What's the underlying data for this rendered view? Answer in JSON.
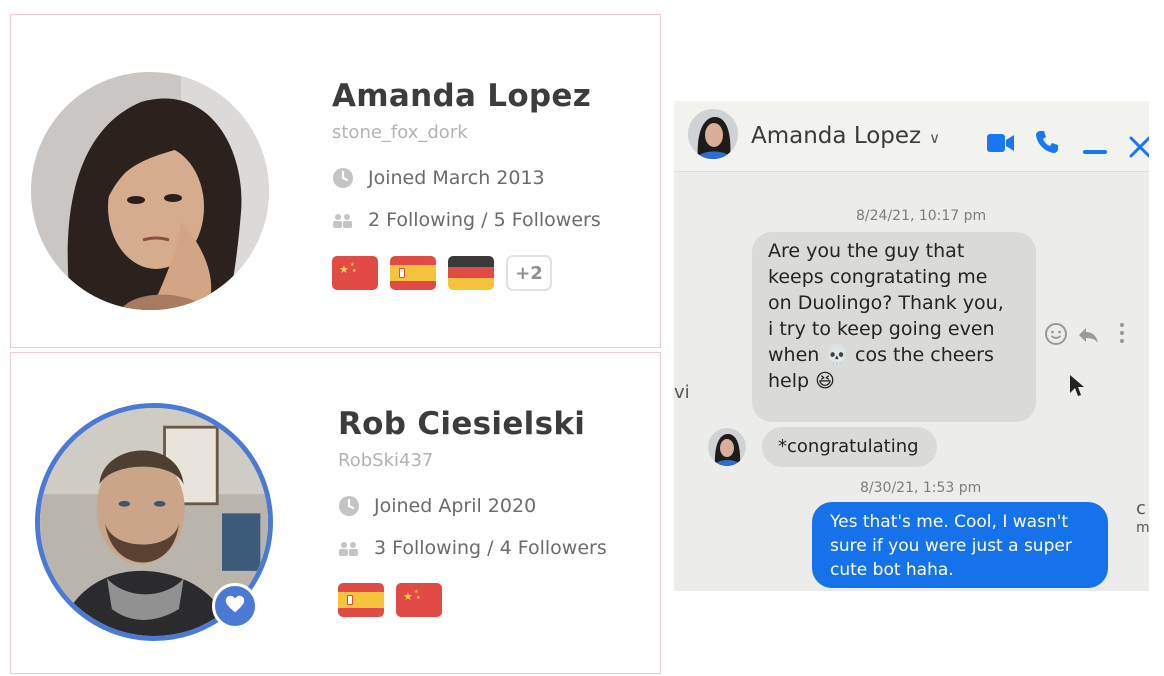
{
  "profiles": [
    {
      "name": "Amanda Lopez",
      "username": "stone_fox_dork",
      "joined": "Joined March 2013",
      "follow": "2 Following / 5 Followers",
      "flags": [
        "china",
        "spain",
        "germany"
      ],
      "more_flags": "+2"
    },
    {
      "name": "Rob Ciesielski",
      "username": "RobSki437",
      "joined": "Joined April 2020",
      "follow": "3 Following / 4 Followers",
      "flags": [
        "spain",
        "china"
      ]
    }
  ],
  "chat": {
    "contact_name": "Amanda Lopez",
    "header_icons": [
      "video-call-icon",
      "phone-icon",
      "minimize-icon",
      "close-icon"
    ],
    "messages": [
      {
        "timestamp": "8/24/21, 10:17 pm"
      },
      {
        "from": "them",
        "lines": [
          "Are you the guy that",
          "keeps congratating me",
          "on Duolingo? Thank you,",
          "i try to keep going even",
          "when 💀 cos the cheers",
          "help 😆"
        ]
      },
      {
        "from": "them",
        "text": "*congratulating"
      },
      {
        "timestamp": "8/30/21, 1:53 pm"
      },
      {
        "from": "me",
        "lines": [
          "Yes that's me. Cool, I wasn't",
          "sure if you were just a super",
          "cute bot haha."
        ]
      }
    ],
    "side_fragments": [
      "vi",
      "c",
      "m"
    ]
  },
  "colors": {
    "card_border": "#f2c9cc",
    "name_text": "#3c3c3c",
    "accent_blue": "#4a7ad4",
    "messenger_blue": "#1672ea"
  }
}
